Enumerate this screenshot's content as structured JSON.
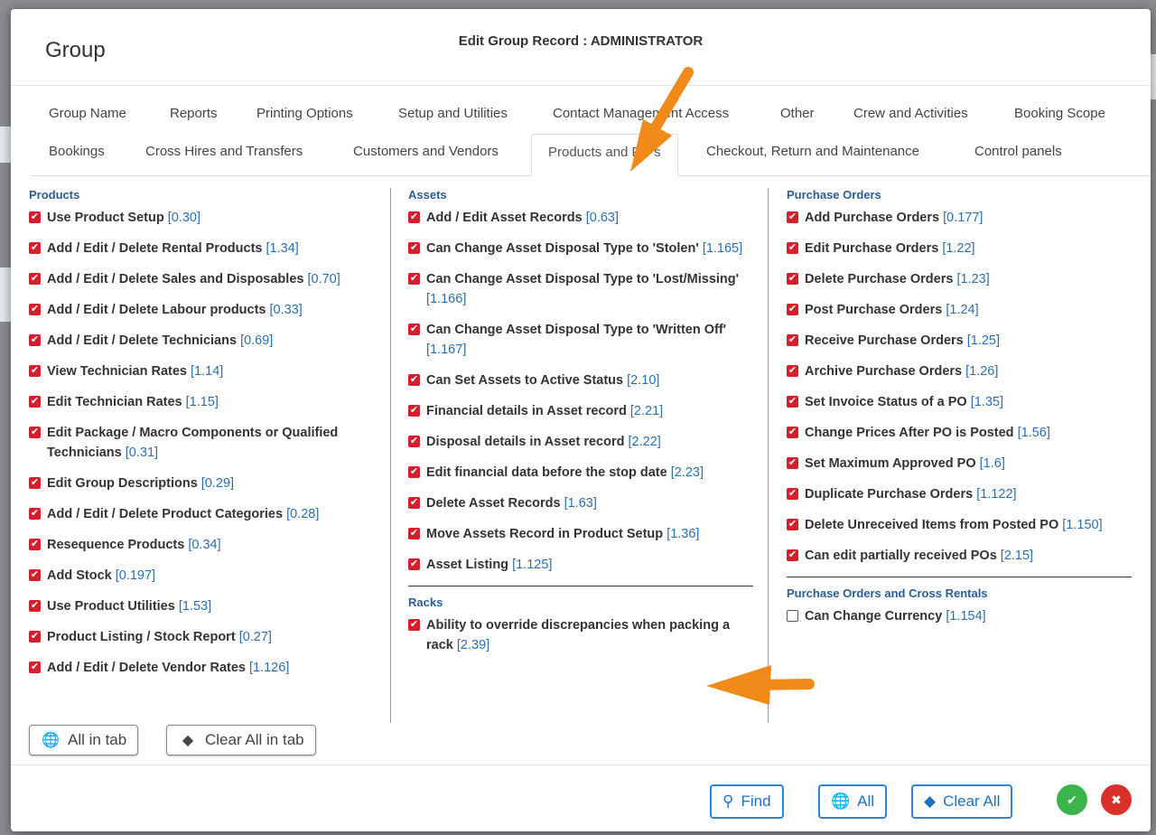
{
  "modal": {
    "title": "Group",
    "subtitle": "Edit Group Record : ADMINISTRATOR"
  },
  "tabs_row1": [
    "Group Name",
    "Reports",
    "Printing Options",
    "Setup and Utilities",
    "Contact Management Access",
    "Other",
    "Crew and Activities",
    "Booking Scope"
  ],
  "tabs_row2": [
    "Bookings",
    "Cross Hires and Transfers",
    "Customers and Vendors",
    "Products and PO's",
    "Checkout, Return and Maintenance",
    "Control panels"
  ],
  "active_tab": "Products and PO's",
  "products": {
    "title": "Products",
    "items": [
      {
        "label": "Use Product Setup",
        "code": "[0.30]",
        "checked": true
      },
      {
        "label": "Add / Edit / Delete Rental Products",
        "code": "[1.34]",
        "checked": true
      },
      {
        "label": "Add / Edit / Delete Sales and Disposables",
        "code": "[0.70]",
        "checked": true
      },
      {
        "label": "Add / Edit / Delete Labour products",
        "code": "[0.33]",
        "checked": true
      },
      {
        "label": "Add / Edit / Delete Technicians",
        "code": "[0.69]",
        "checked": true
      },
      {
        "label": "View Technician Rates",
        "code": "[1.14]",
        "checked": true
      },
      {
        "label": "Edit Technician Rates",
        "code": "[1.15]",
        "checked": true
      },
      {
        "label": "Edit Package / Macro Components or Qualified Technicians",
        "code": "[0.31]",
        "checked": true
      },
      {
        "label": "Edit Group Descriptions",
        "code": "[0.29]",
        "checked": true
      },
      {
        "label": "Add / Edit / Delete Product Categories",
        "code": "[0.28]",
        "checked": true
      },
      {
        "label": "Resequence Products",
        "code": "[0.34]",
        "checked": true
      },
      {
        "label": "Add Stock",
        "code": "[0.197]",
        "checked": true
      },
      {
        "label": "Use Product Utilities",
        "code": "[1.53]",
        "checked": true
      },
      {
        "label": "Product Listing / Stock Report",
        "code": "[0.27]",
        "checked": true
      },
      {
        "label": "Add / Edit / Delete Vendor Rates",
        "code": "[1.126]",
        "checked": true
      }
    ]
  },
  "assets": {
    "title": "Assets",
    "items": [
      {
        "label": "Add / Edit Asset Records",
        "code": "[0.63]",
        "checked": true
      },
      {
        "label": "Can Change Asset Disposal Type to 'Stolen'",
        "code": "[1.165]",
        "checked": true
      },
      {
        "label": "Can Change Asset Disposal Type to 'Lost/Missing'",
        "code": "[1.166]",
        "checked": true
      },
      {
        "label": "Can Change Asset Disposal Type to 'Written Off'",
        "code": "[1.167]",
        "checked": true
      },
      {
        "label": "Can Set Assets to Active Status",
        "code": "[2.10]",
        "checked": true
      },
      {
        "label": "Financial details in Asset record",
        "code": "[2.21]",
        "checked": true
      },
      {
        "label": "Disposal details in Asset record",
        "code": "[2.22]",
        "checked": true
      },
      {
        "label": "Edit financial data before the stop date",
        "code": "[2.23]",
        "checked": true
      },
      {
        "label": "Delete Asset Records",
        "code": "[1.63]",
        "checked": true
      },
      {
        "label": "Move Assets Record in Product Setup",
        "code": "[1.36]",
        "checked": true
      },
      {
        "label": "Asset Listing",
        "code": "[1.125]",
        "checked": true
      }
    ]
  },
  "racks": {
    "title": "Racks",
    "items": [
      {
        "label": "Ability to override discrepancies when packing a rack",
        "code": "[2.39]",
        "checked": true
      }
    ]
  },
  "purchase_orders": {
    "title": "Purchase Orders",
    "items": [
      {
        "label": "Add Purchase Orders",
        "code": "[0.177]",
        "checked": true
      },
      {
        "label": "Edit Purchase Orders",
        "code": "[1.22]",
        "checked": true
      },
      {
        "label": "Delete Purchase Orders",
        "code": "[1.23]",
        "checked": true
      },
      {
        "label": "Post Purchase Orders",
        "code": "[1.24]",
        "checked": true
      },
      {
        "label": "Receive Purchase Orders",
        "code": "[1.25]",
        "checked": true
      },
      {
        "label": "Archive Purchase Orders",
        "code": "[1.26]",
        "checked": true
      },
      {
        "label": "Set Invoice Status of a PO",
        "code": "[1.35]",
        "checked": true
      },
      {
        "label": "Change Prices After PO is Posted",
        "code": "[1.56]",
        "checked": true
      },
      {
        "label": "Set Maximum Approved PO",
        "code": "[1.6]",
        "checked": true
      },
      {
        "label": "Duplicate Purchase Orders",
        "code": "[1.122]",
        "checked": true
      },
      {
        "label": "Delete Unreceived Items from Posted PO",
        "code": "[1.150]",
        "checked": true
      },
      {
        "label": "Can edit partially received POs",
        "code": "[2.15]",
        "checked": true
      }
    ]
  },
  "cross_rentals": {
    "title": "Purchase Orders and Cross Rentals",
    "items": [
      {
        "label": "Can Change Currency",
        "code": "[1.154]",
        "checked": false
      }
    ]
  },
  "buttons": {
    "all_in_tab": "All in tab",
    "clear_all_in_tab": "Clear All in tab",
    "find": "Find",
    "all": "All",
    "clear_all": "Clear All"
  },
  "icons": {
    "globe": "globe-icon",
    "eraser": "eraser-icon",
    "search": "search-icon",
    "confirm": "check-circle-icon",
    "cancel": "close-circle-icon",
    "annotation_arrow": "arrow-icon"
  },
  "colors": {
    "checkbox_checked": "#d71f2b",
    "section_title": "#2a5e96",
    "code": "#2a6fb0",
    "primary_button": "#1e72c4",
    "confirm": "#3bb54a",
    "cancel": "#d9302a",
    "annotation_arrow": "#f28a1a"
  }
}
